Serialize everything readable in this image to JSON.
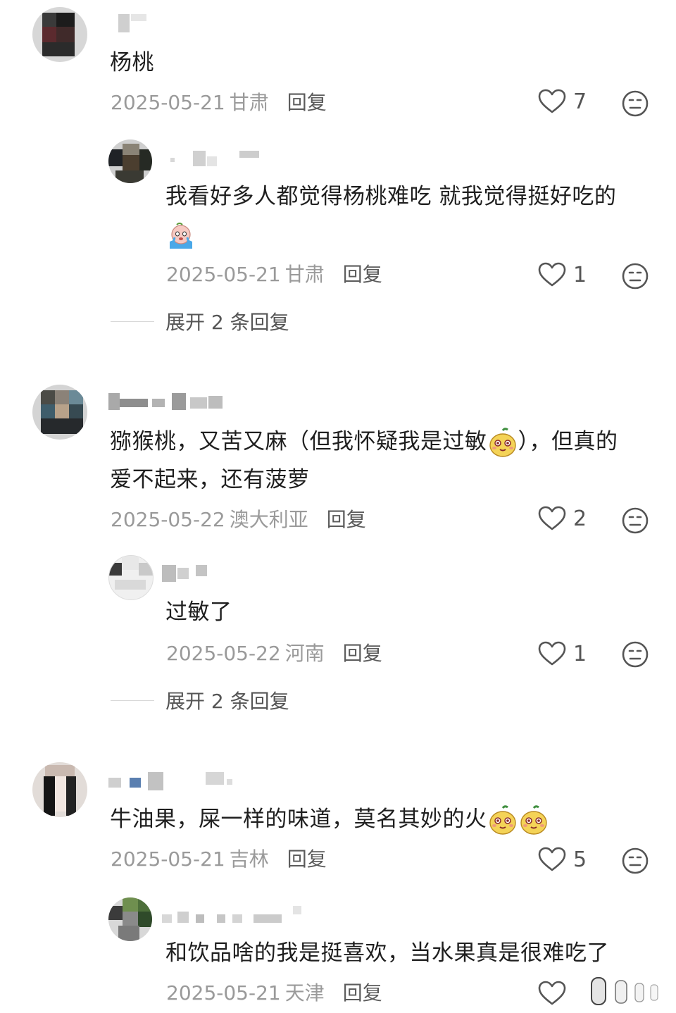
{
  "comments": [
    {
      "text": "杨桃",
      "date": "2025-05-21",
      "location": "甘肃",
      "reply_label": "回复",
      "likes": "7",
      "replies": [
        {
          "text_line1": "我看好多人都觉得杨桃难吃 就我觉得挺好吃的",
          "date": "2025-05-21",
          "location": "甘肃",
          "reply_label": "回复",
          "likes": "1"
        }
      ],
      "expand_label": "展开 2 条回复"
    },
    {
      "text_line1_a": "猕猴桃，又苦又麻（但我怀疑我是过敏",
      "text_line1_b": "），但真的",
      "text_line2": "爱不起来，还有菠萝",
      "date": "2025-05-22",
      "location": "澳大利亚",
      "reply_label": "回复",
      "likes": "2",
      "replies": [
        {
          "text": "过敏了",
          "date": "2025-05-22",
          "location": "河南",
          "reply_label": "回复",
          "likes": "1"
        }
      ],
      "expand_label": "展开 2 条回复"
    },
    {
      "text": "牛油果，屎一样的味道，莫名其妙的火",
      "date": "2025-05-21",
      "location": "吉林",
      "reply_label": "回复",
      "likes": "5",
      "replies": [
        {
          "text": "和饮品啥的我是挺喜欢，当水果真是很难吃了",
          "date": "2025-05-21",
          "location": "天津",
          "reply_label": "回复"
        }
      ]
    }
  ],
  "icons": {
    "like": "heart-outline-icon",
    "dislike": "neutral-face-icon",
    "emoji_cry": "crying-emoji-icon",
    "emoji_mango": "mango-face-emoji-icon"
  },
  "colors": {
    "text": "#1f1f1f",
    "meta": "#9a9a9a",
    "action": "#555555"
  }
}
